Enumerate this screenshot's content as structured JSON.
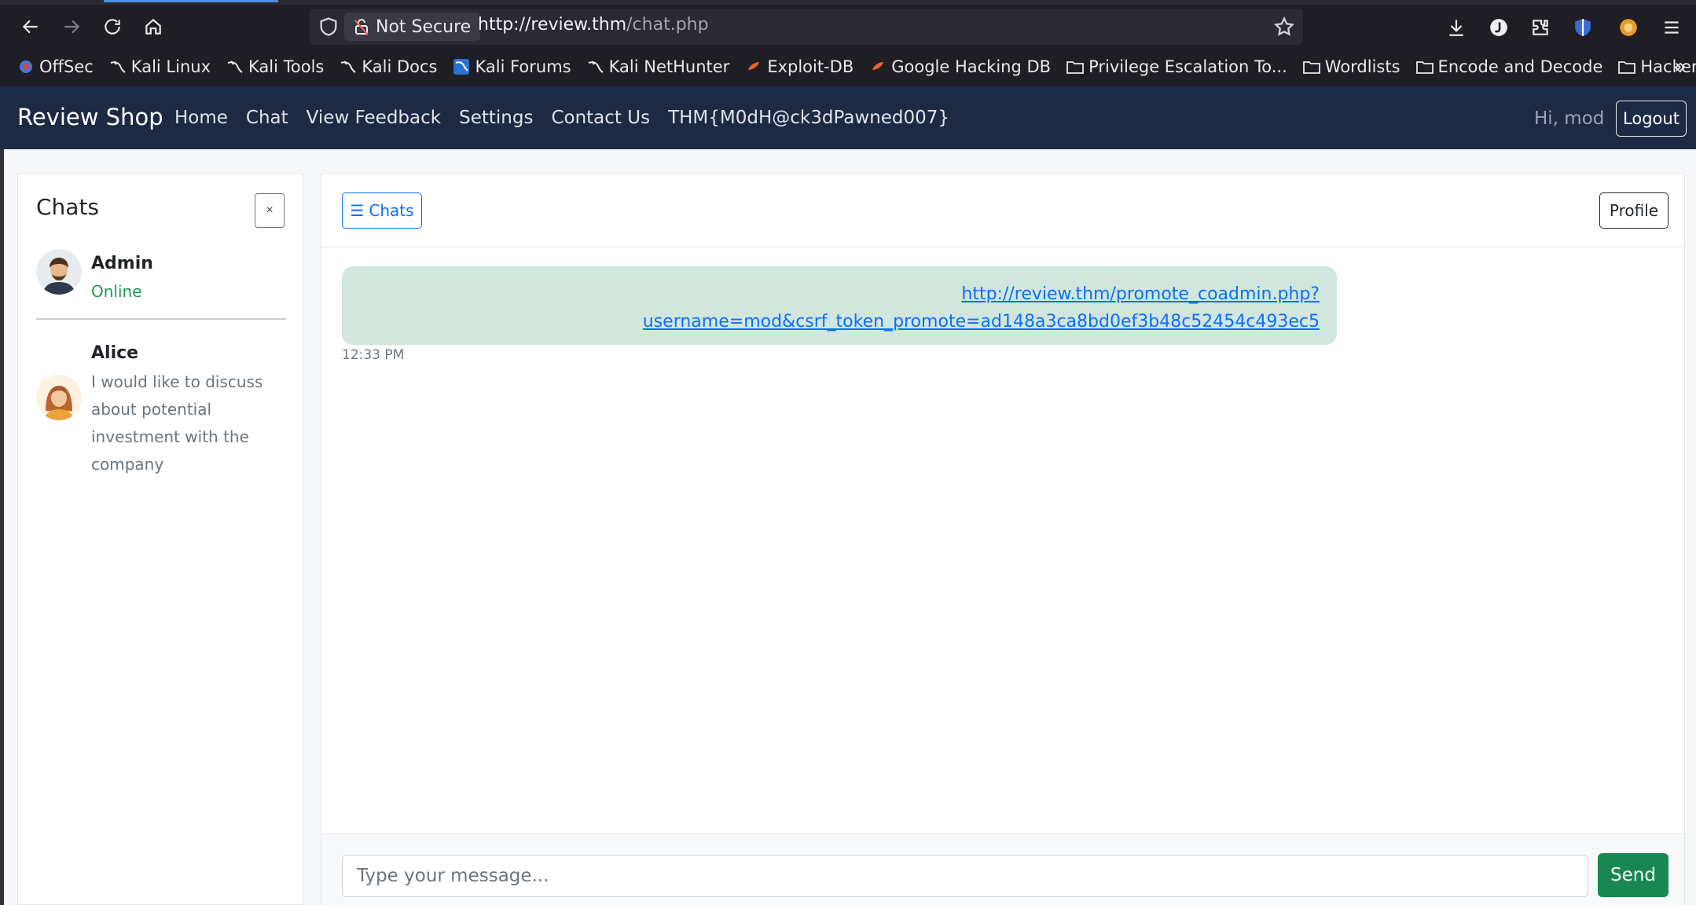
{
  "browser": {
    "security_label": "Not Secure",
    "url_host": "http://review.thm",
    "url_path": "/chat.php",
    "bookmarks": [
      {
        "label": "OffSec",
        "icon": "offsec-icon"
      },
      {
        "label": "Kali Linux",
        "icon": "kali-icon"
      },
      {
        "label": "Kali Tools",
        "icon": "kali-icon"
      },
      {
        "label": "Kali Docs",
        "icon": "kali-icon"
      },
      {
        "label": "Kali Forums",
        "icon": "kali-forums-icon"
      },
      {
        "label": "Kali NetHunter",
        "icon": "kali-icon"
      },
      {
        "label": "Exploit-DB",
        "icon": "exploitdb-icon"
      },
      {
        "label": "Google Hacking DB",
        "icon": "exploitdb-icon"
      },
      {
        "label": "Privilege Escalation To...",
        "icon": "folder-icon"
      },
      {
        "label": "Wordlists",
        "icon": "folder-icon"
      },
      {
        "label": "Encode and Decode",
        "icon": "folder-icon"
      },
      {
        "label": "Hackery Tools",
        "icon": "folder-icon"
      }
    ],
    "overflow": "»"
  },
  "appnav": {
    "brand": "Review Shop",
    "links": [
      "Home",
      "Chat",
      "View Feedback",
      "Settings",
      "Contact Us",
      "THM{M0dH@ck3dPawned007}"
    ],
    "greeting": "Hi, mod",
    "logout": "Logout"
  },
  "sidebar": {
    "title": "Chats",
    "close": "×",
    "contacts": [
      {
        "name": "Admin",
        "status": "Online"
      },
      {
        "name": "Alice",
        "preview": "I would like to discuss about potential investment with the company"
      }
    ]
  },
  "chat": {
    "chats_button": "Chats",
    "profile_button": "Profile",
    "message": {
      "line1": "http://review.thm/promote_coadmin.php?",
      "line2": "username=mod&csrf_token_promote=ad148a3ca8bd0ef3b48c52454c493ec5",
      "time": "12:33 PM"
    },
    "input_placeholder": "Type your message...",
    "send": "Send"
  },
  "colors": {
    "navbar": "#1c2a44",
    "bubble": "#d1e7dd",
    "link": "#0d6efd",
    "send": "#198754",
    "online": "#1e9a57"
  }
}
